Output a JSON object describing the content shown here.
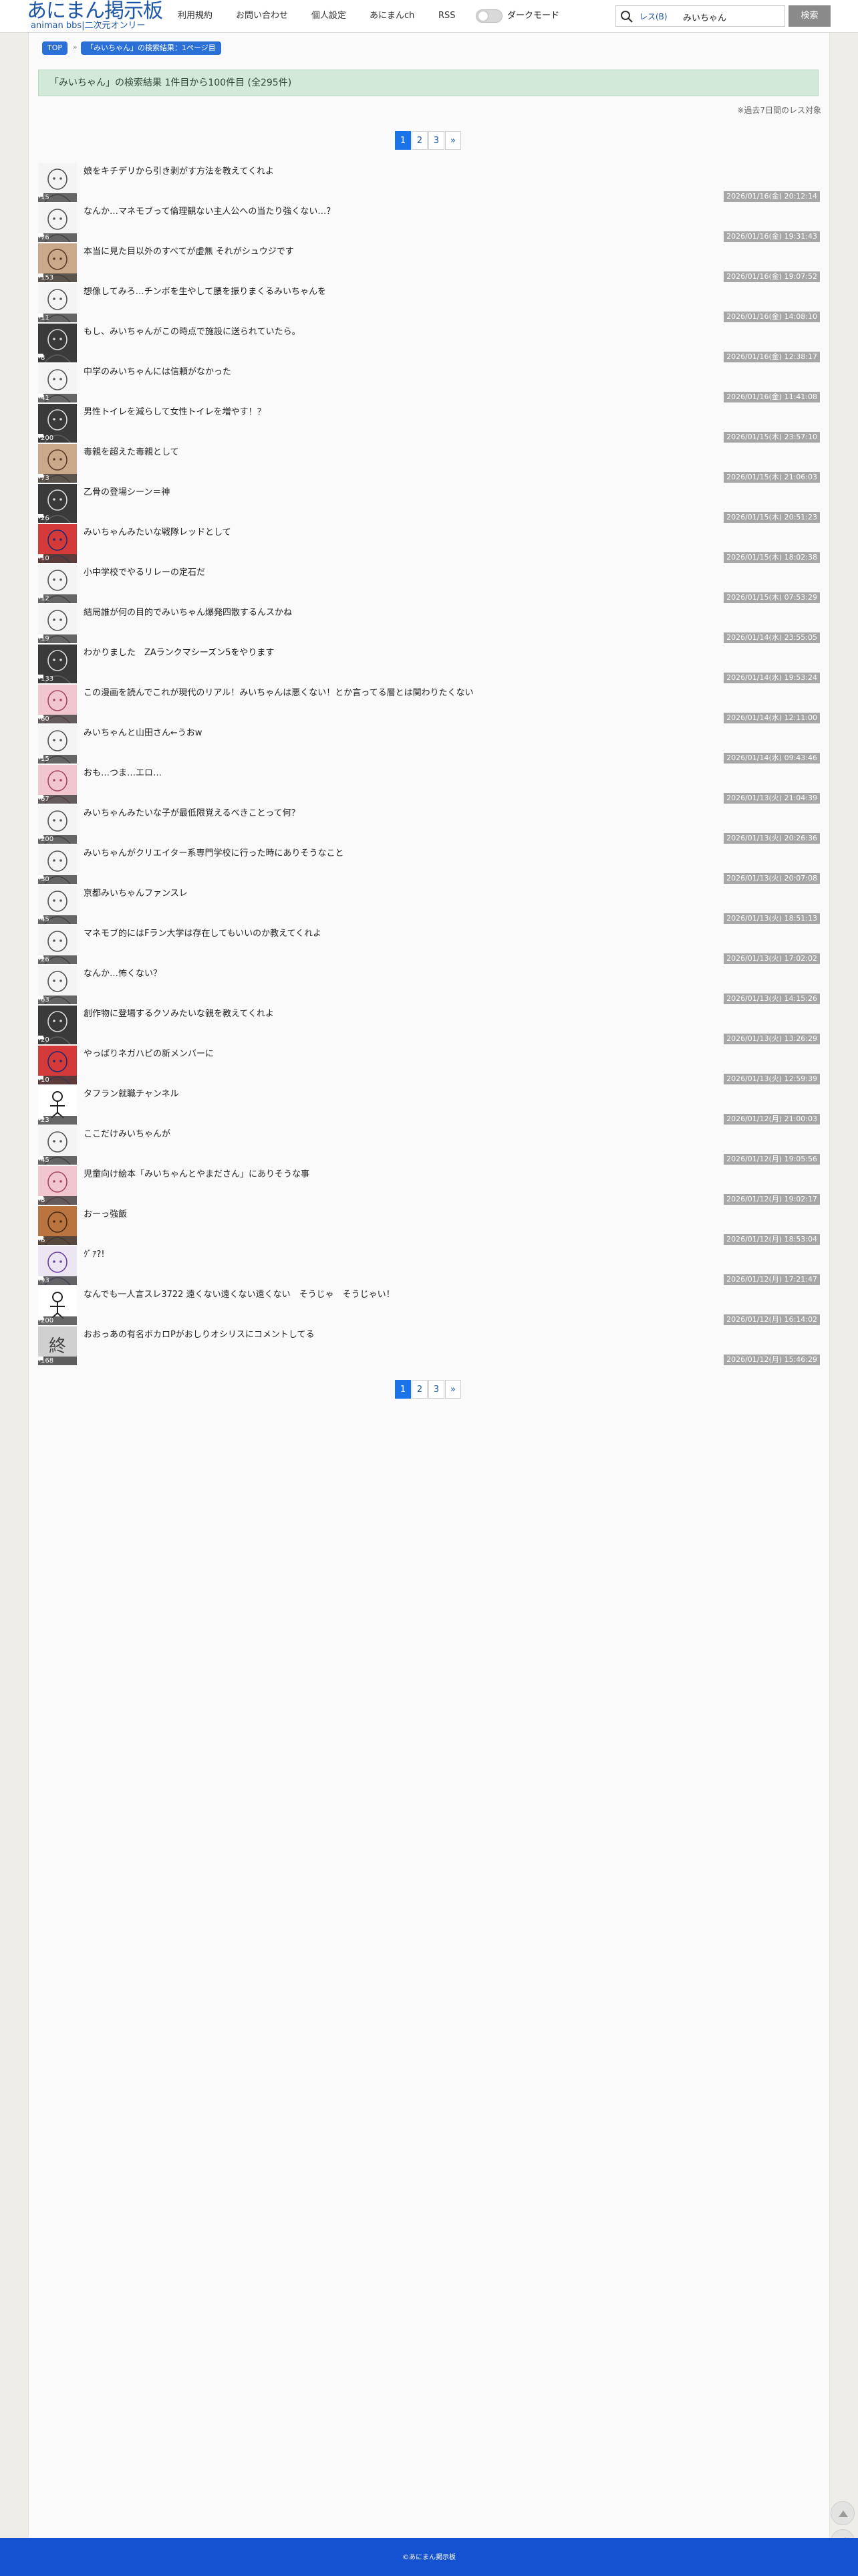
{
  "site": {
    "logo_main": "あにまん掲示板",
    "logo_sub": "animan bbs|二次元オンリー"
  },
  "nav": {
    "links": [
      "利用規約",
      "お問い合わせ",
      "個人設定",
      "あにまんch",
      "RSS"
    ],
    "dark_mode_label": "ダークモード",
    "dark_mode_on": false
  },
  "search": {
    "target": "レス(B)",
    "query": "みいちゃん",
    "button": "検索"
  },
  "breadcrumb": {
    "top": "TOP",
    "current": "「みいちゃん」の検索結果：1ページ目"
  },
  "results": {
    "banner": "「みいちゃん」の検索結果 1件目から100件目 (全295件)",
    "note": "※過去7日間のレス対象"
  },
  "pager": {
    "pages": [
      "1",
      "2",
      "3"
    ],
    "current": "1",
    "next": "»"
  },
  "threads": [
    {
      "title": "娘をキチデリから引き剥がす方法を教えてくれよ",
      "count": "15",
      "date": "2026/01/16(金) 20:12:14",
      "thumb": "sketch"
    },
    {
      "title": "なんか…マネモブって倫理観ない主人公への当たり強くない…？",
      "count": "76",
      "date": "2026/01/16(金) 19:31:43",
      "thumb": "sketch"
    },
    {
      "title": "本当に見た目以外のすべてが虚無 それがシュウジです",
      "count": "153",
      "date": "2026/01/16(金) 19:07:52",
      "thumb": "color"
    },
    {
      "title": "想像してみろ…チンポを生やして腰を振りまくるみいちゃんを",
      "count": "11",
      "date": "2026/01/16(金) 14:08:10",
      "thumb": "sketch"
    },
    {
      "title": "もし、みいちゃんがこの時点で施設に送られていたら。",
      "count": "8",
      "date": "2026/01/16(金) 12:38:17",
      "thumb": "dark"
    },
    {
      "title": "中学のみいちゃんには信頼がなかった",
      "count": "41",
      "date": "2026/01/16(金) 11:41:08",
      "thumb": "sketch"
    },
    {
      "title": "男性トイレを減らして女性トイレを増やす！？",
      "count": "200",
      "date": "2026/01/15(木) 23:57:10",
      "thumb": "dark"
    },
    {
      "title": "毒親を超えた毒親として",
      "count": "73",
      "date": "2026/01/15(木) 21:06:03",
      "thumb": "color"
    },
    {
      "title": "乙骨の登場シーン＝神",
      "count": "26",
      "date": "2026/01/15(木) 20:51:23",
      "thumb": "dark"
    },
    {
      "title": "みいちゃんみたいな戦隊レッドとして",
      "count": "10",
      "date": "2026/01/15(木) 18:02:38",
      "thumb": "red"
    },
    {
      "title": "小中学校でやるリレーの定石だ",
      "count": "12",
      "date": "2026/01/15(木) 07:53:29",
      "thumb": "sketch"
    },
    {
      "title": "結局誰が何の目的でみいちゃん爆発四散するんスかね",
      "count": "19",
      "date": "2026/01/14(水) 23:55:05",
      "thumb": "sketch"
    },
    {
      "title": "わかりました　ZAランクマシーズン5をやります",
      "count": "133",
      "date": "2026/01/14(水) 19:53:24",
      "thumb": "dark"
    },
    {
      "title": "この漫画を読んでこれが現代のリアル！みいちゃんは悪くない！とか言ってる層とは関わりたくない",
      "count": "60",
      "date": "2026/01/14(水) 12:11:00",
      "thumb": "pink"
    },
    {
      "title": "みいちゃんと山田さん←うおw",
      "count": "15",
      "date": "2026/01/14(水) 09:43:46",
      "thumb": "sketch"
    },
    {
      "title": "おも…つま…エロ…",
      "count": "67",
      "date": "2026/01/13(火) 21:04:39",
      "thumb": "pink"
    },
    {
      "title": "みいちゃんみたいな子が最低限覚えるべきことって何？",
      "count": "200",
      "date": "2026/01/13(火) 20:26:36",
      "thumb": "sketch"
    },
    {
      "title": "みいちゃんがクリエイター系専門学校に行った時にありそうなこと",
      "count": "30",
      "date": "2026/01/13(火) 20:07:08",
      "thumb": "sketch"
    },
    {
      "title": "京都みいちゃんファンスレ",
      "count": "45",
      "date": "2026/01/13(火) 18:51:13",
      "thumb": "sketch"
    },
    {
      "title": "マネモブ的にはFラン大学は存在してもいいのか教えてくれよ",
      "count": "26",
      "date": "2026/01/13(火) 17:02:02",
      "thumb": "sketch"
    },
    {
      "title": "なんか…怖くない？",
      "count": "63",
      "date": "2026/01/13(火) 14:15:26",
      "thumb": "sketch"
    },
    {
      "title": "創作物に登場するクソみたいな親を教えてくれよ",
      "count": "20",
      "date": "2026/01/13(火) 13:26:29",
      "thumb": "dark"
    },
    {
      "title": "やっぱりネガハピの新メンバーに",
      "count": "10",
      "date": "2026/01/13(火) 12:59:39",
      "thumb": "red"
    },
    {
      "title": "タフラン就職チャンネル",
      "count": "23",
      "date": "2026/01/12(月) 21:00:03",
      "thumb": "stick"
    },
    {
      "title": "ここだけみいちゃんが",
      "count": "45",
      "date": "2026/01/12(月) 19:05:56",
      "thumb": "sketch"
    },
    {
      "title": "児童向け絵本「みいちゃんとやまださん」にありそうな事",
      "count": "8",
      "date": "2026/01/12(月) 19:02:17",
      "thumb": "pink"
    },
    {
      "title": "おーっ強飯",
      "count": "6",
      "date": "2026/01/12(月) 18:53:04",
      "thumb": "brown"
    },
    {
      "title": "ｸﾞｱ?!",
      "count": "93",
      "date": "2026/01/12(月) 17:21:47",
      "thumb": "purple"
    },
    {
      "title": "なんでも一人言スレ3722 遠くない遠くない遠くない　そうじゃ　そうじゃい！",
      "count": "200",
      "date": "2026/01/12(月) 16:14:02",
      "thumb": "stick"
    },
    {
      "title": "おおっあの有名ボカロPがおしりオシリスにコメントしてる",
      "count": "168",
      "date": "2026/01/12(月) 15:46:29",
      "thumb": "end"
    }
  ],
  "thread_count_icon": "comment-icon",
  "footer": {
    "copyright": "©あにまん掲示板"
  },
  "colors": {
    "brand": "#1c56a6",
    "accent": "#1a73e8",
    "banner_bg": "#d2e8d9",
    "footer_bg": "#1552d1"
  }
}
